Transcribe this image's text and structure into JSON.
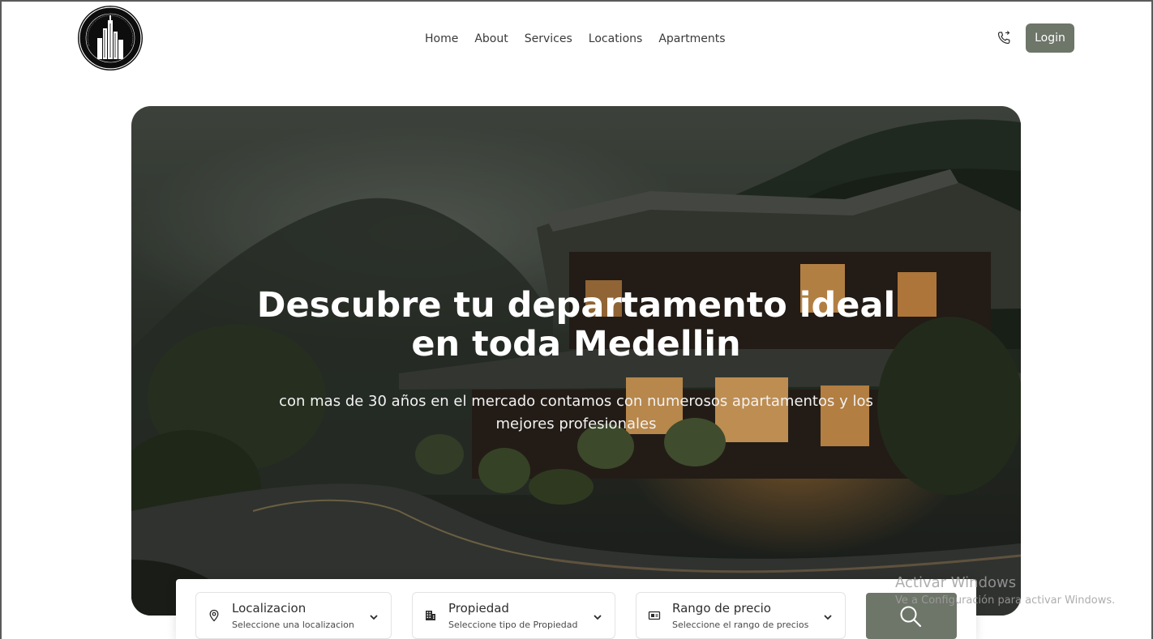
{
  "brand": {
    "logo_text": "FURNISHED APARTMENT MEDELLIN",
    "logo_icon": "city-skyline-logo"
  },
  "nav": {
    "items": [
      {
        "label": "Home"
      },
      {
        "label": "About"
      },
      {
        "label": "Services"
      },
      {
        "label": "Locations"
      },
      {
        "label": "Apartments"
      }
    ],
    "phone_icon": "phone-icon",
    "login_label": "Login"
  },
  "hero": {
    "title_line1": "Descubre tu departamento ideal",
    "title_line2": "en toda Medellin",
    "subtitle": "con mas de 30 años en el mercado contamos con numerosos apartamentos y los mejores profesionales"
  },
  "search": {
    "location": {
      "label": "Localizacion",
      "hint": "Seleccione una localizacion",
      "icon": "map-pin-icon"
    },
    "property": {
      "label": "Propiedad",
      "hint": "Seleccione tipo de Propiedad",
      "icon": "building-icon"
    },
    "price": {
      "label": "Rango de precio",
      "hint": "Seleccione el rango de precios",
      "icon": "price-tag-icon"
    },
    "button_icon": "search-icon"
  },
  "watermark": {
    "line1": "Activar Windows",
    "line2": "Ve a Configuración para activar Windows."
  },
  "colors": {
    "accent": "#6e7569",
    "text": "#3a3a3a",
    "logo_bg": "#0d0d0d"
  }
}
